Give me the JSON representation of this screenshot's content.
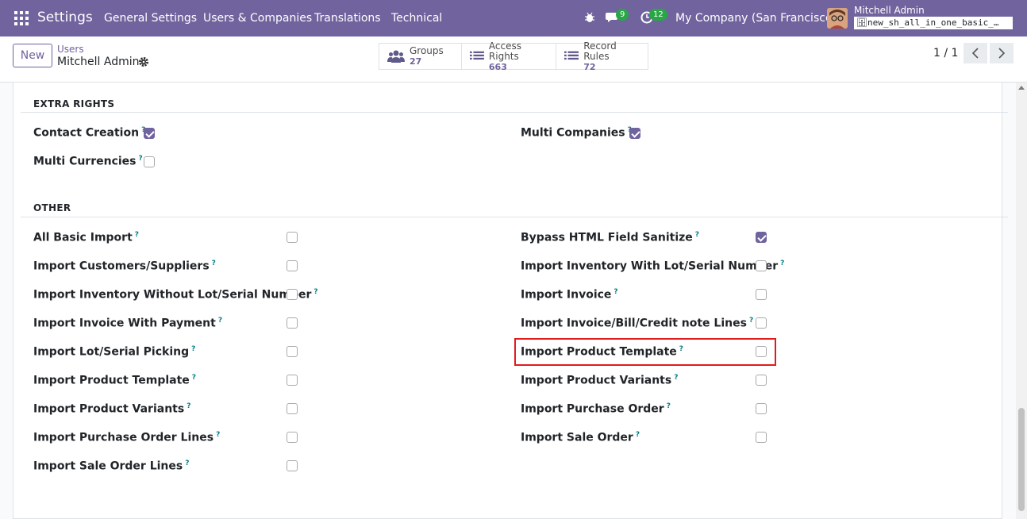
{
  "navbar": {
    "brand": "Settings",
    "menu": [
      "General Settings",
      "Users & Companies",
      "Translations",
      "Technical"
    ],
    "messages_count": "9",
    "activities_count": "12",
    "company": "My Company (San Francisco)",
    "user_name": "Mitchell Admin",
    "db_name": "new_sh_all_in_one_basic_…"
  },
  "control": {
    "new_label": "New",
    "breadcrumb_parent": "Users",
    "breadcrumb_current": "Mitchell Admin",
    "smart_buttons": [
      {
        "label": "Groups",
        "value": "27",
        "icon": "users-icon"
      },
      {
        "label": "Access Rights",
        "value": "663",
        "icon": "list-icon"
      },
      {
        "label": "Record Rules",
        "value": "72",
        "icon": "list-icon"
      }
    ],
    "pager": "1 / 1"
  },
  "sections": {
    "extra_rights": {
      "title": "EXTRA RIGHTS",
      "fields": [
        {
          "label": "Contact Creation",
          "checked": true
        },
        {
          "label": "Multi Companies",
          "checked": true
        },
        {
          "label": "Multi Currencies",
          "checked": false
        }
      ]
    },
    "other": {
      "title": "OTHER",
      "left": [
        {
          "label": "All Basic Import",
          "checked": false
        },
        {
          "label": "Import Customers/Suppliers",
          "checked": false
        },
        {
          "label": "Import Inventory Without Lot/Serial Number",
          "checked": false
        },
        {
          "label": "Import Invoice With Payment",
          "checked": false
        },
        {
          "label": "Import Lot/Serial Picking",
          "checked": false
        },
        {
          "label": "Import Product Template",
          "checked": false
        },
        {
          "label": "Import Product Variants",
          "checked": false
        },
        {
          "label": "Import Purchase Order Lines",
          "checked": false
        },
        {
          "label": "Import Sale Order Lines",
          "checked": false
        }
      ],
      "right": [
        {
          "label": "Bypass HTML Field Sanitize",
          "checked": true
        },
        {
          "label": "Import Inventory With Lot/Serial Number",
          "checked": false
        },
        {
          "label": "Import Invoice",
          "checked": false
        },
        {
          "label": "Import Invoice/Bill/Credit note Lines",
          "checked": false
        },
        {
          "label": "Import Product Template",
          "checked": false
        },
        {
          "label": "Import Product Variants",
          "checked": false
        },
        {
          "label": "Import Purchase Order",
          "checked": false
        },
        {
          "label": "Import Sale Order",
          "checked": false
        }
      ]
    }
  },
  "help_mark": "?",
  "colors": {
    "brand": "#71639e",
    "highlight": "#e01b1b",
    "badge": "#28a745"
  }
}
